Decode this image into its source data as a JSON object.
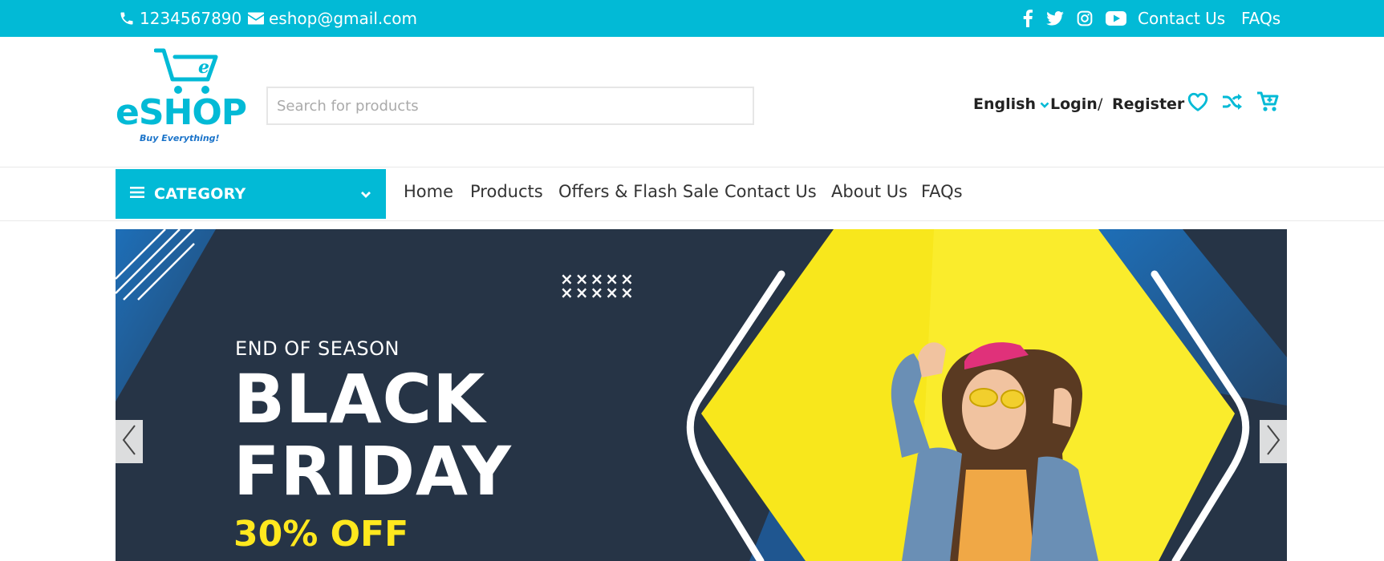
{
  "topbar": {
    "phone": "1234567890",
    "email": "eshop@gmail.com",
    "social_icons": [
      "facebook-icon",
      "twitter-icon",
      "instagram-icon",
      "youtube-icon"
    ],
    "contact_label": "Contact Us",
    "faqs_label": "FAQs",
    "bg_color": "#02bad6"
  },
  "header": {
    "logo_text": "eSHOP",
    "logo_tagline": "Buy Everything!",
    "search_placeholder": "Search for products",
    "search_value": "",
    "language": "English",
    "login_label": "Login",
    "separator": "/",
    "register_label": "Register",
    "icons": [
      "heart-icon",
      "shuffle-icon",
      "cart-icon"
    ]
  },
  "nav": {
    "category_label": "CATEGORY",
    "links": [
      "Home",
      "Products",
      "Offers & Flash Sale",
      "Contact Us",
      "About Us",
      "FAQs"
    ]
  },
  "banner": {
    "kicker": "END OF SEASON",
    "line1": "BLACK",
    "line2": "FRIDAY",
    "offer": "30% OFF",
    "bg_color": "#263446",
    "accent_color": "#ffe81e"
  }
}
